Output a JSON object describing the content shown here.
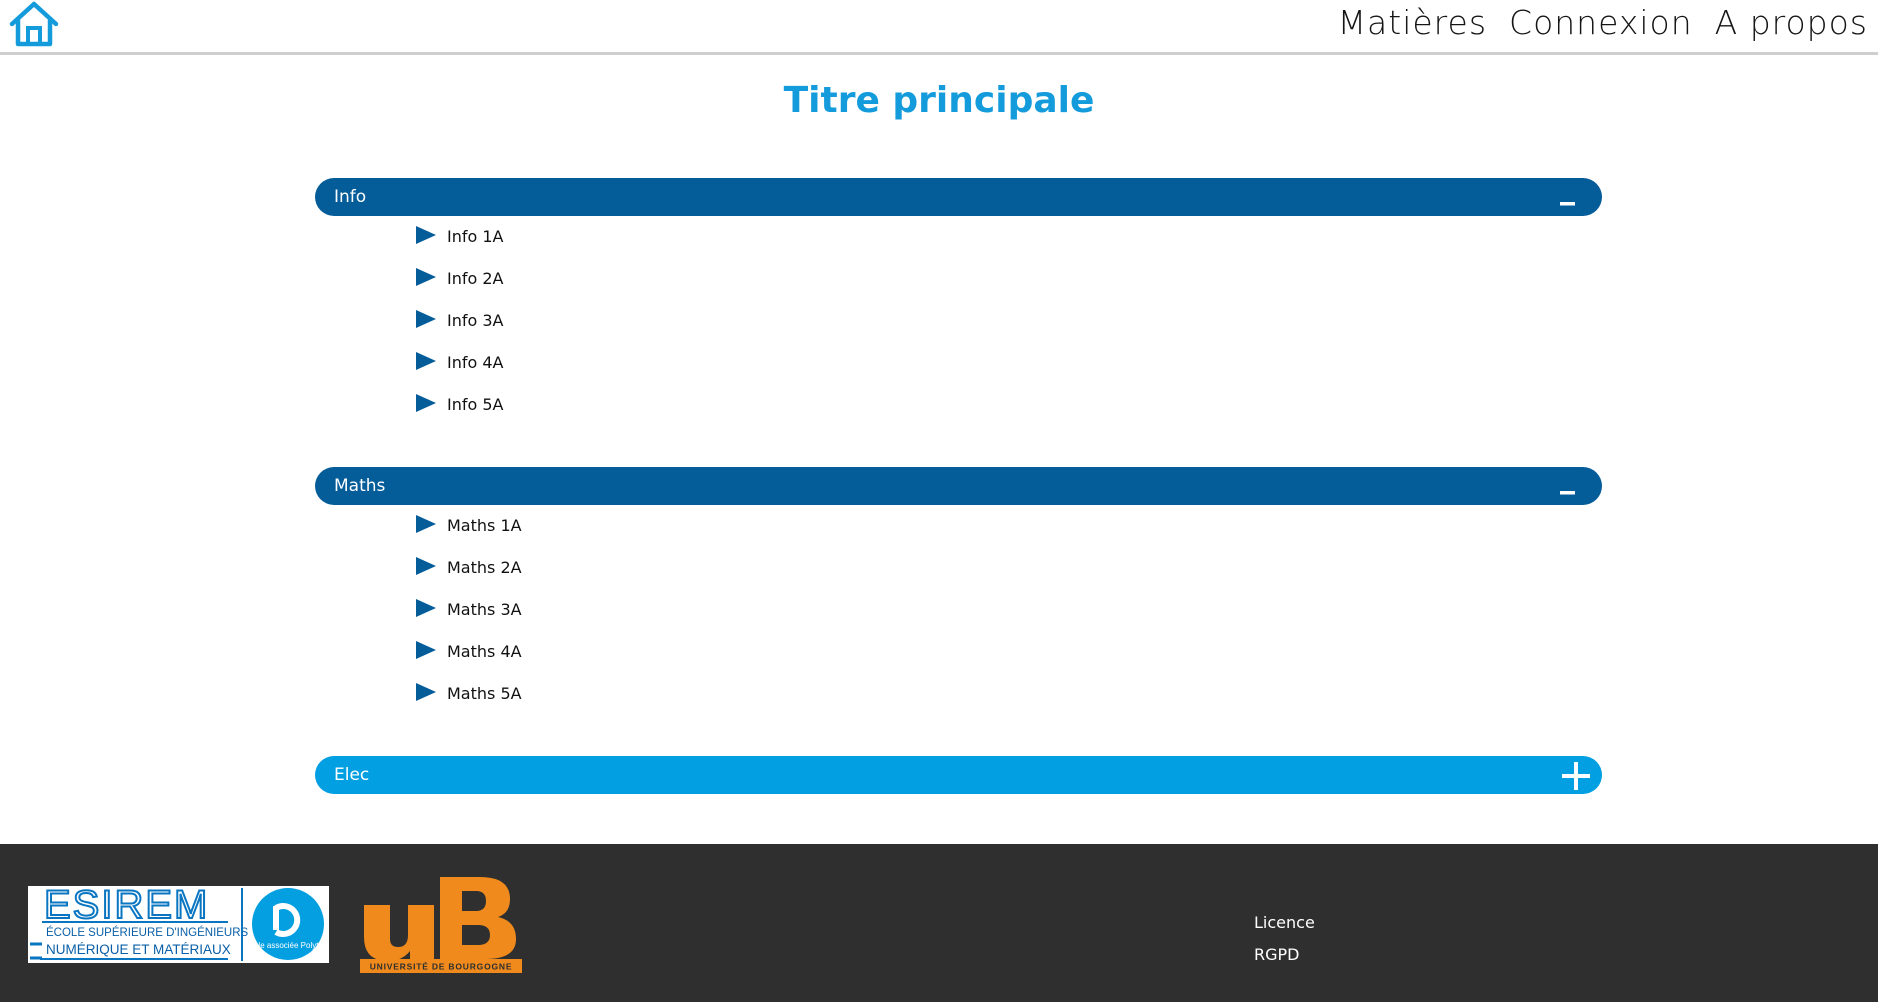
{
  "header": {
    "home_icon": "home-icon",
    "nav": [
      {
        "label": "Matières"
      },
      {
        "label": "Connexion"
      },
      {
        "label": "A propos"
      }
    ]
  },
  "main": {
    "title": "Titre principale",
    "sections": [
      {
        "label": "Info",
        "toggle_icon": "minus-icon",
        "expanded": true,
        "items": [
          "Info 1A",
          "Info 2A",
          "Info 3A",
          "Info 4A",
          "Info 5A"
        ]
      },
      {
        "label": "Maths",
        "toggle_icon": "minus-icon",
        "expanded": true,
        "items": [
          "Maths 1A",
          "Maths 2A",
          "Maths 3A",
          "Maths 4A",
          "Maths 5A"
        ]
      },
      {
        "label": "Elec",
        "toggle_icon": "plus-icon",
        "expanded": false,
        "items": []
      }
    ]
  },
  "footer": {
    "logos": {
      "esirem": {
        "name": "ESIREM",
        "line1": "ÉCOLE SUPÉRIEURE D'INGÉNIEURS",
        "line2": "NUMÉRIQUE ET MATÉRIAUX",
        "badge": "École associée Polytech"
      },
      "ub": {
        "name": "uB",
        "caption": "UNIVERSITÉ DE BOURGOGNE"
      }
    },
    "links": [
      {
        "label": "Licence"
      },
      {
        "label": "RGPD"
      }
    ]
  },
  "colors": {
    "accent": "#149bdb",
    "bar_dark": "#045c99",
    "bar_light": "#029fe2",
    "footer_bg": "#2f2f2f",
    "ub_orange": "#f08a1c"
  }
}
